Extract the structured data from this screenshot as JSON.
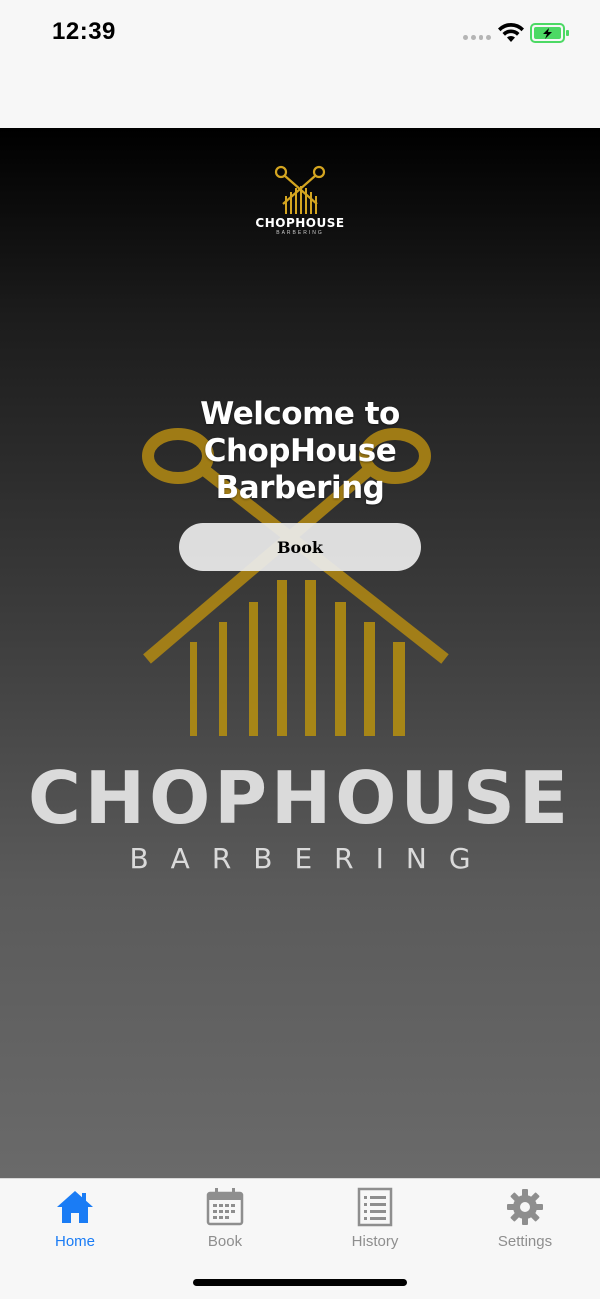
{
  "status_bar": {
    "time": "12:39"
  },
  "brand": {
    "small_name": "CHOPHOUSE",
    "small_sub": "BARBERING",
    "big_name": "CHOPHOUSE",
    "big_sub": "BARBERING",
    "gold": "#d4a520"
  },
  "hero": {
    "welcome": "Welcome to ChopHouse Barbering",
    "book_button": "Book"
  },
  "tabs": [
    {
      "label": "Home",
      "icon": "house-icon",
      "active": true
    },
    {
      "label": "Book",
      "icon": "calendar-icon",
      "active": false
    },
    {
      "label": "History",
      "icon": "list-icon",
      "active": false
    },
    {
      "label": "Settings",
      "icon": "gear-icon",
      "active": false
    }
  ],
  "colors": {
    "active_tab": "#1a7cf5",
    "inactive_tab": "#8e8e8e",
    "battery_green": "#4cd964"
  }
}
